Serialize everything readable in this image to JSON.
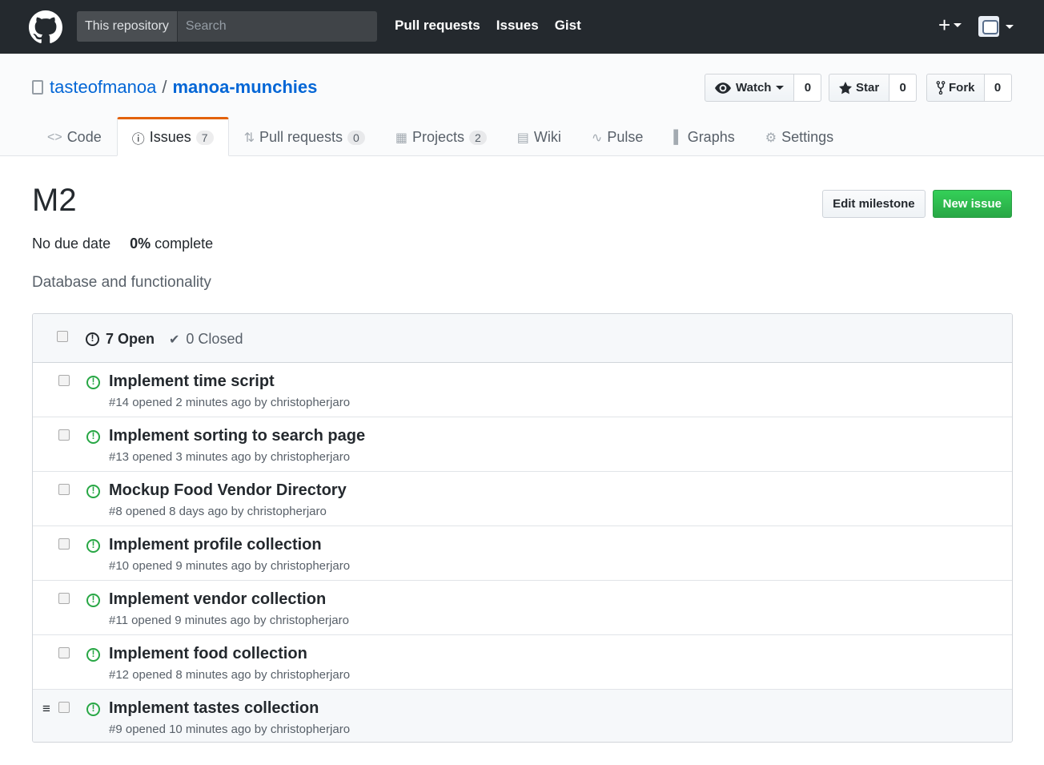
{
  "header": {
    "search_scope": "This repository",
    "search_placeholder": "Search",
    "nav": [
      "Pull requests",
      "Issues",
      "Gist"
    ],
    "plus_label": "+"
  },
  "repo": {
    "owner": "tasteofmanoa",
    "separator": "/",
    "name": "manoa-munchies",
    "watch_label": "Watch",
    "watch_count": "0",
    "star_label": "Star",
    "star_count": "0",
    "fork_label": "Fork",
    "fork_count": "0"
  },
  "tabs": [
    {
      "label": "Code",
      "icon": "code-icon"
    },
    {
      "label": "Issues",
      "icon": "issue-icon",
      "count": "7"
    },
    {
      "label": "Pull requests",
      "icon": "pull-request-icon",
      "count": "0"
    },
    {
      "label": "Projects",
      "icon": "project-icon",
      "count": "2"
    },
    {
      "label": "Wiki",
      "icon": "book-icon"
    },
    {
      "label": "Pulse",
      "icon": "pulse-icon"
    },
    {
      "label": "Graphs",
      "icon": "graph-icon"
    },
    {
      "label": "Settings",
      "icon": "gear-icon"
    }
  ],
  "milestone": {
    "title": "M2",
    "due": "No due date",
    "percent": "0%",
    "complete_label": "complete",
    "description": "Database and functionality",
    "edit_label": "Edit milestone",
    "new_issue_label": "New issue"
  },
  "issues_header": {
    "open": "7 Open",
    "closed": "0 Closed"
  },
  "issues": [
    {
      "title": "Implement time script",
      "meta": "#14 opened 2 minutes ago by christopherjaro"
    },
    {
      "title": "Implement sorting to search page",
      "meta": "#13 opened 3 minutes ago by christopherjaro"
    },
    {
      "title": "Mockup Food Vendor Directory",
      "meta": "#8 opened 8 days ago by christopherjaro"
    },
    {
      "title": "Implement profile collection",
      "meta": "#10 opened 9 minutes ago by christopherjaro"
    },
    {
      "title": "Implement vendor collection",
      "meta": "#11 opened 9 minutes ago by christopherjaro"
    },
    {
      "title": "Implement food collection",
      "meta": "#12 opened 8 minutes ago by christopherjaro"
    },
    {
      "title": "Implement tastes collection",
      "meta": "#9 opened 10 minutes ago by christopherjaro"
    }
  ],
  "colors": {
    "header_bg": "#24292e",
    "link": "#0366d6",
    "open_green": "#28a745",
    "tab_accent": "#e36209"
  }
}
